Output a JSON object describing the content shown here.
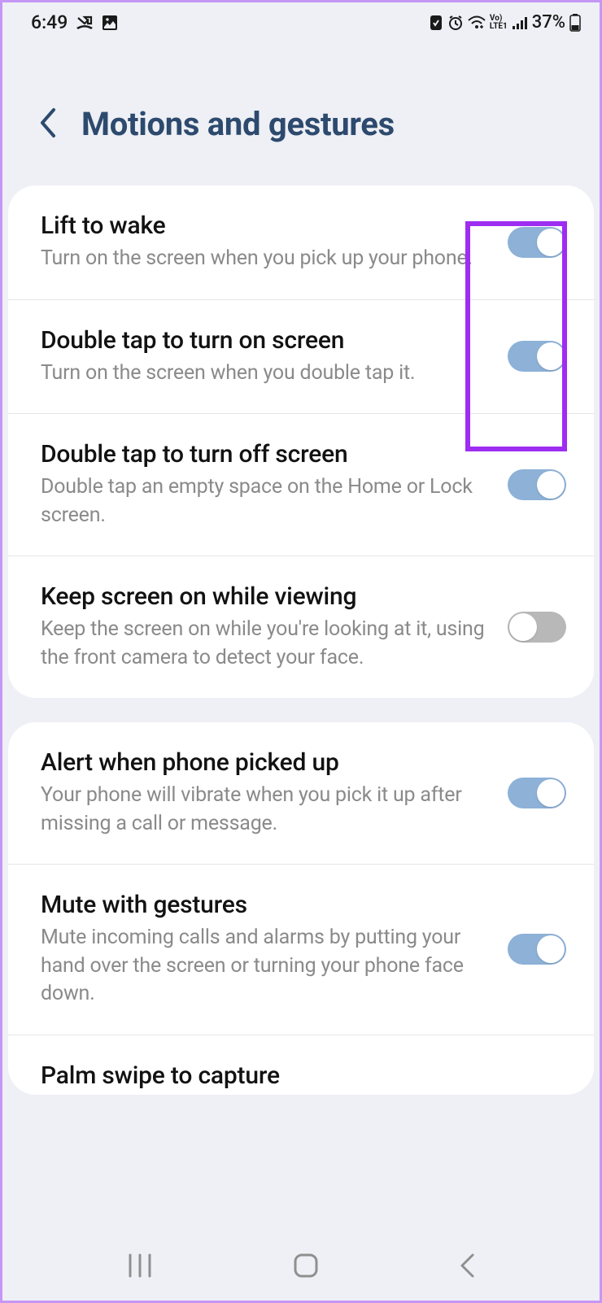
{
  "statusBar": {
    "time": "6:49",
    "batteryText": "37%"
  },
  "header": {
    "title": "Motions and gestures"
  },
  "groups": [
    {
      "items": [
        {
          "title": "Lift to wake",
          "desc": "Turn on the screen when you pick up your phone.",
          "on": true
        },
        {
          "title": "Double tap to turn on screen",
          "desc": "Turn on the screen when you double tap it.",
          "on": true
        },
        {
          "title": "Double tap to turn off screen",
          "desc": "Double tap an empty space on the Home or Lock screen.",
          "on": true
        },
        {
          "title": "Keep screen on while viewing",
          "desc": "Keep the screen on while you're looking at it, using the front camera to detect your face.",
          "on": false
        }
      ]
    },
    {
      "items": [
        {
          "title": "Alert when phone picked up",
          "desc": "Your phone will vibrate when you pick it up after missing a call or message.",
          "on": true
        },
        {
          "title": "Mute with gestures",
          "desc": "Mute incoming calls and alarms by putting your hand over the screen or turning your phone face down.",
          "on": true
        },
        {
          "title": "Palm swipe to capture",
          "desc": "",
          "on": true
        }
      ]
    }
  ]
}
